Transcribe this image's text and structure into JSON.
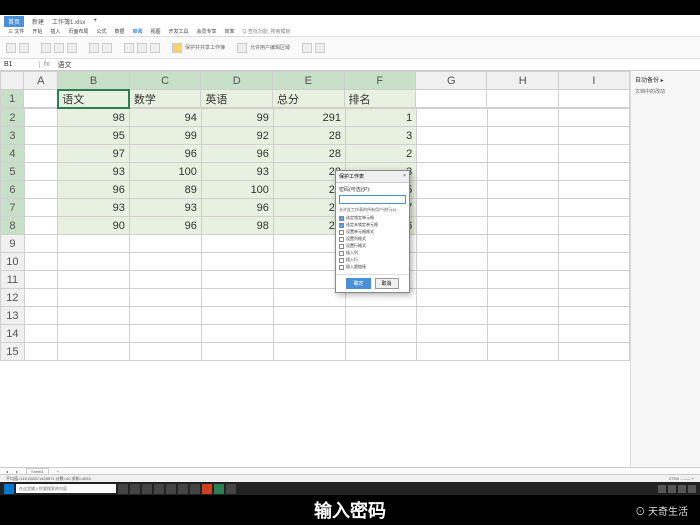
{
  "titlebar": {
    "t1": "首页",
    "t2": "新建",
    "t3": "工作簿1.xlsx",
    "tright": ""
  },
  "ribbon_tabs": [
    "三 文件",
    "开始",
    "插入",
    "页面布局",
    "公式",
    "数据",
    "审阅",
    "视图",
    "开发工具",
    "会员专享",
    "效率",
    "Q 查找功能, 搜索模板"
  ],
  "active_tab": "审阅",
  "formula": {
    "name": "B1",
    "fx": "fx",
    "content": "语文"
  },
  "cols": [
    "",
    "A",
    "B",
    "C",
    "D",
    "E",
    "F",
    "G",
    "H",
    "I"
  ],
  "rows": [
    "1",
    "2",
    "3",
    "4",
    "5",
    "6",
    "7",
    "8",
    "9",
    "10",
    "11",
    "12",
    "13",
    "14",
    "15"
  ],
  "headers": {
    "B": "语文",
    "C": "数学",
    "D": "英语",
    "E": "总分",
    "F": "排名"
  },
  "chart_data": {
    "type": "table",
    "columns": [
      "语文",
      "数学",
      "英语",
      "总分",
      "排名"
    ],
    "rows": [
      [
        98,
        94,
        99,
        291,
        1
      ],
      [
        95,
        99,
        92,
        28,
        3
      ],
      [
        97,
        96,
        96,
        28,
        2
      ],
      [
        93,
        100,
        93,
        28,
        3
      ],
      [
        96,
        89,
        100,
        28,
        5
      ],
      [
        93,
        93,
        96,
        28,
        7
      ],
      [
        90,
        96,
        98,
        28,
        6
      ]
    ]
  },
  "dialog": {
    "title": "保护工作表",
    "close": "×",
    "label": "密码(可选)(P):",
    "input": "",
    "note": "允许此工作表的所有用户进行(A):",
    "opts": [
      "选定锁定单元格",
      "选定未锁定单元格",
      "设置单元格格式",
      "设置列格式",
      "设置行格式",
      "插入列",
      "插入行",
      "插入超链接"
    ],
    "checked": [
      0,
      1
    ],
    "ok": "确定",
    "cancel": "取消"
  },
  "sheet_tabs": {
    "s1": "Sheet1",
    "add": "+"
  },
  "status": {
    "left": "平均值=115.228571428571 计数=40 求和=4033",
    "right": "273% - —— +"
  },
  "taskbar": {
    "search": "在这里输入你要搜索的内容"
  },
  "right_pane": {
    "hdr": "自动备份 ▸",
    "line": "文档中的改动"
  },
  "caption": "输入密码",
  "brand": "⊙ 天奇生活"
}
